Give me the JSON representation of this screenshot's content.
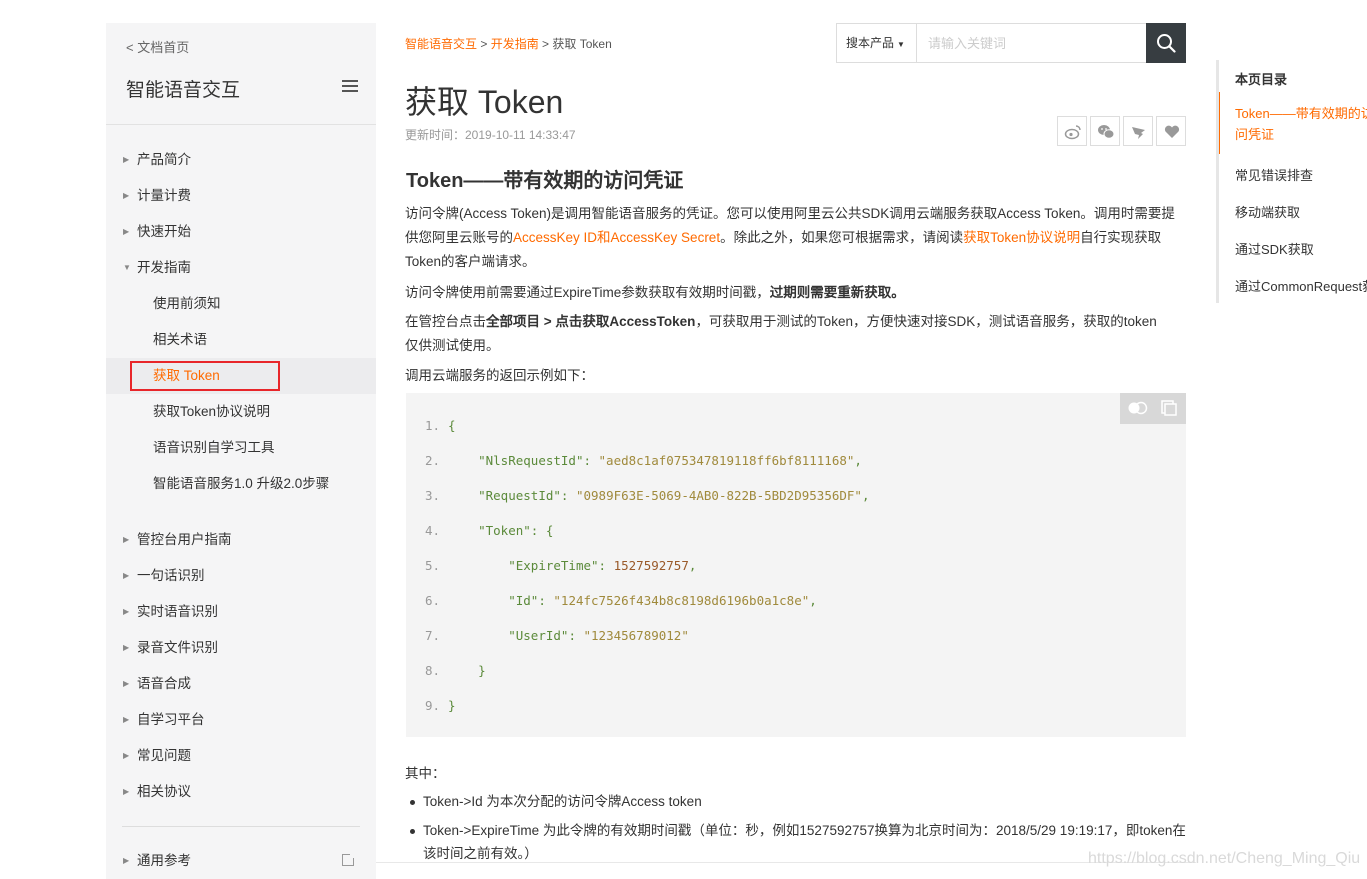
{
  "sidebar": {
    "back_link": "< 文档首页",
    "title": "智能语音交互",
    "items": [
      {
        "label": "产品简介"
      },
      {
        "label": "计量计费"
      },
      {
        "label": "快速开始"
      },
      {
        "label": "开发指南",
        "expanded": true
      }
    ],
    "sub_items": [
      {
        "label": "使用前须知"
      },
      {
        "label": "相关术语"
      },
      {
        "label": "获取 Token",
        "active": true
      },
      {
        "label": "获取Token协议说明"
      },
      {
        "label": "语音识别自学习工具"
      },
      {
        "label": "智能语音服务1.0 升级2.0步骤"
      }
    ],
    "items_after": [
      {
        "label": "管控台用户指南"
      },
      {
        "label": "一句话识别"
      },
      {
        "label": "实时语音识别"
      },
      {
        "label": "录音文件识别"
      },
      {
        "label": "语音合成"
      },
      {
        "label": "自学习平台"
      },
      {
        "label": "常见问题"
      },
      {
        "label": "相关协议"
      }
    ],
    "general_ref": "通用参考"
  },
  "breadcrumb": {
    "crumb1": "智能语音交互",
    "sep1": " > ",
    "crumb2": "开发指南",
    "sep2": " > ",
    "current": "获取 Token"
  },
  "search": {
    "scope": "搜本产品",
    "placeholder": "请输入关键词"
  },
  "page": {
    "title": "获取 Token",
    "updated": "更新时间：2019-10-11 14:33:47",
    "section_title": "Token——带有效期的访问凭证",
    "p1_a": "访问令牌(Access Token)是调用智能语音服务的凭证。您可以使用阿里云公共SDK调用云端服务获取Access Token。调用时需要提供您阿里云账号的",
    "p1_link1": "AccessKey ID和AccessKey Secret",
    "p1_b": "。除此之外，如果您可根据需求，请阅读",
    "p1_link2": "获取Token协议说明",
    "p1_c": "自行实现获取Token的客户端请求。",
    "p2_a": "访问令牌使用前需要通过ExpireTime参数获取有效期时间戳，",
    "p2_b": "过期则需要重新获取。",
    "p3_a": "在管控台点击",
    "p3_b": "全部项目 > 点击获取AccessToken",
    "p3_c": "，可获取用于测试的Token，方便快速对接SDK，测试语音服务，获取的token仅供测试使用。",
    "p4": "调用云端服务的返回示例如下：",
    "p5": "其中：",
    "bullet1": "Token->Id 为本次分配的访问令牌Access token",
    "bullet2": "Token->ExpireTime 为此令牌的有效期时间戳（单位：秒，例如1527592757换算为北京时间为：2018/5/29 19:19:17，即token在该时间之前有效。）"
  },
  "code": {
    "lines": [
      {
        "n": "1.",
        "indent": "",
        "key": "",
        "sep": "",
        "val": "",
        "val_type": "",
        "tail": "{"
      },
      {
        "n": "2.",
        "indent": "    ",
        "key": "\"NlsRequestId\"",
        "sep": ": ",
        "val": "\"aed8c1af075347819118ff6bf8111168\"",
        "val_type": "str",
        "tail": ","
      },
      {
        "n": "3.",
        "indent": "    ",
        "key": "\"RequestId\"",
        "sep": ": ",
        "val": "\"0989F63E-5069-4AB0-822B-5BD2D95356DF\"",
        "val_type": "str",
        "tail": ","
      },
      {
        "n": "4.",
        "indent": "    ",
        "key": "\"Token\"",
        "sep": ": ",
        "val": "",
        "val_type": "",
        "tail": "{"
      },
      {
        "n": "5.",
        "indent": "        ",
        "key": "\"ExpireTime\"",
        "sep": ": ",
        "val": "1527592757",
        "val_type": "num",
        "tail": ","
      },
      {
        "n": "6.",
        "indent": "        ",
        "key": "\"Id\"",
        "sep": ": ",
        "val": "\"124fc7526f434b8c8198d6196b0a1c8e\"",
        "val_type": "str",
        "tail": ","
      },
      {
        "n": "7.",
        "indent": "        ",
        "key": "\"UserId\"",
        "sep": ": ",
        "val": "\"123456789012\"",
        "val_type": "str",
        "tail": ""
      },
      {
        "n": "8.",
        "indent": "    ",
        "key": "",
        "sep": "",
        "val": "",
        "val_type": "",
        "tail": "}"
      },
      {
        "n": "9.",
        "indent": "",
        "key": "",
        "sep": "",
        "val": "",
        "val_type": "",
        "tail": "}"
      }
    ]
  },
  "toc": {
    "title": "本页目录",
    "items": [
      {
        "label": "Token——带有效期的访问凭证",
        "active": true
      },
      {
        "label": "常见错误排查"
      },
      {
        "label": "移动端获取"
      },
      {
        "label": "通过SDK获取"
      },
      {
        "label": "通过CommonRequest获取"
      }
    ]
  },
  "watermark": "https://blog.csdn.net/Cheng_Ming_Qiu",
  "colors": {
    "accent": "#ff6a00",
    "highlight_border": "#e8262a",
    "search_button": "#373d41"
  }
}
